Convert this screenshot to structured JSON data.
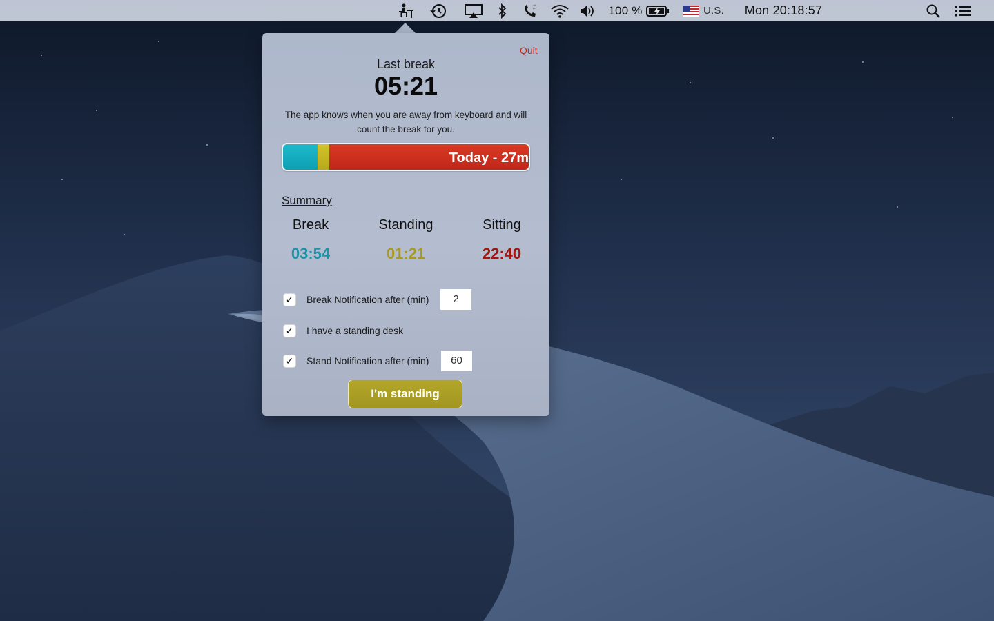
{
  "menubar": {
    "battery_percent": "100 %",
    "input_source": "U.S.",
    "clock": "Mon 20:18:57",
    "icons": [
      "stand-desk-app-icon",
      "time-machine-icon",
      "airplay-icon",
      "bluetooth-icon",
      "phone-icon",
      "wifi-icon",
      "volume-icon",
      "battery-icon",
      "us-flag-icon",
      "spotlight-search-icon",
      "notification-center-icon"
    ]
  },
  "popover": {
    "quit": "Quit",
    "last_break_label": "Last break",
    "last_break_time": "05:21",
    "info_text": "The app knows when you are away from keyboard and will count the break for you.",
    "today_label": "Today - 27m",
    "today_bar": {
      "break_minutes": 3.9,
      "standing_minutes": 1.35,
      "sitting_minutes": 22.67,
      "colors": {
        "break": "#12adc0",
        "standing": "#c4b624",
        "sitting": "#cd2f1e"
      }
    },
    "summary": {
      "heading": "Summary",
      "columns": [
        {
          "label": "Break",
          "value": "03:54",
          "color": "#1b93a8"
        },
        {
          "label": "Standing",
          "value": "01:21",
          "color": "#a89a1c"
        },
        {
          "label": "Sitting",
          "value": "22:40",
          "color": "#a3160f"
        }
      ]
    },
    "settings": {
      "break_notification": {
        "label": "Break Notification after (min)",
        "checked": true,
        "value": "2"
      },
      "standing_desk": {
        "label": "I have a standing desk",
        "checked": true
      },
      "stand_notification": {
        "label": "Stand Notification after (min)",
        "checked": true,
        "value": "60"
      }
    },
    "button_label": "I'm standing"
  }
}
